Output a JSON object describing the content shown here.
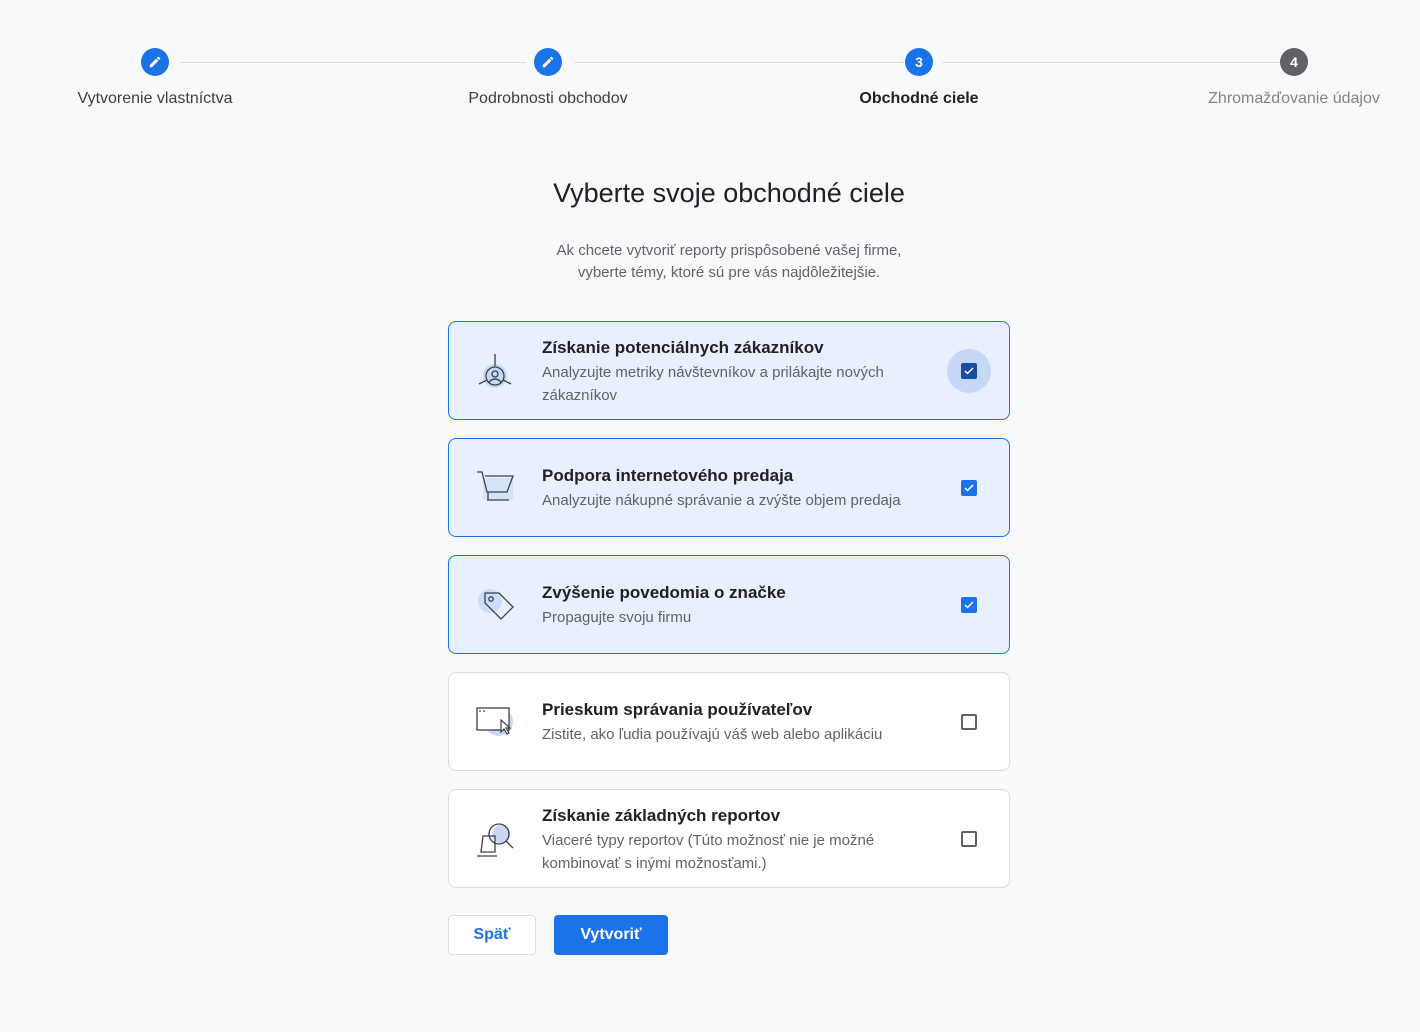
{
  "stepper": {
    "steps": [
      {
        "label": "Vytvorenie vlastníctva",
        "state": "done",
        "number": ""
      },
      {
        "label": "Podrobnosti obchodov",
        "state": "done",
        "number": ""
      },
      {
        "label": "Obchodné ciele",
        "state": "current",
        "number": "3"
      },
      {
        "label": "Zhromažďovanie údajov",
        "state": "todo",
        "number": "4"
      }
    ]
  },
  "header": {
    "title": "Vyberte svoje obchodné ciele",
    "subtitle_line1": "Ak chcete vytvoriť reporty prispôsobené vašej firme,",
    "subtitle_line2": "vyberte témy, ktoré sú pre vás najdôležitejšie."
  },
  "options": [
    {
      "title": "Získanie potenciálnych zákazníkov",
      "description": "Analyzujte metriky návštevníkov a prilákajte nových zákazníkov",
      "checked": true,
      "icon": "target-person-icon"
    },
    {
      "title": "Podpora internetového predaja",
      "description": "Analyzujte nákupné správanie a zvýšte objem predaja",
      "checked": true,
      "icon": "shopping-cart-icon"
    },
    {
      "title": "Zvýšenie povedomia o značke",
      "description": "Propagujte svoju firmu",
      "checked": true,
      "icon": "tag-icon"
    },
    {
      "title": "Prieskum správania používateľov",
      "description": "Zistite, ako ľudia používajú váš web alebo aplikáciu",
      "checked": false,
      "icon": "browser-cursor-icon"
    },
    {
      "title": "Získanie základných reportov",
      "description": "Viaceré typy reportov (Túto možnosť nie je možné kombinovať s inými možnosťami.)",
      "checked": false,
      "icon": "magnifier-report-icon"
    }
  ],
  "buttons": {
    "back_label": "Späť",
    "create_label": "Vytvoriť"
  },
  "colors": {
    "accent": "#1a73e8",
    "selected_bg": "#e8f0fe",
    "background": "#f8f9fa"
  }
}
